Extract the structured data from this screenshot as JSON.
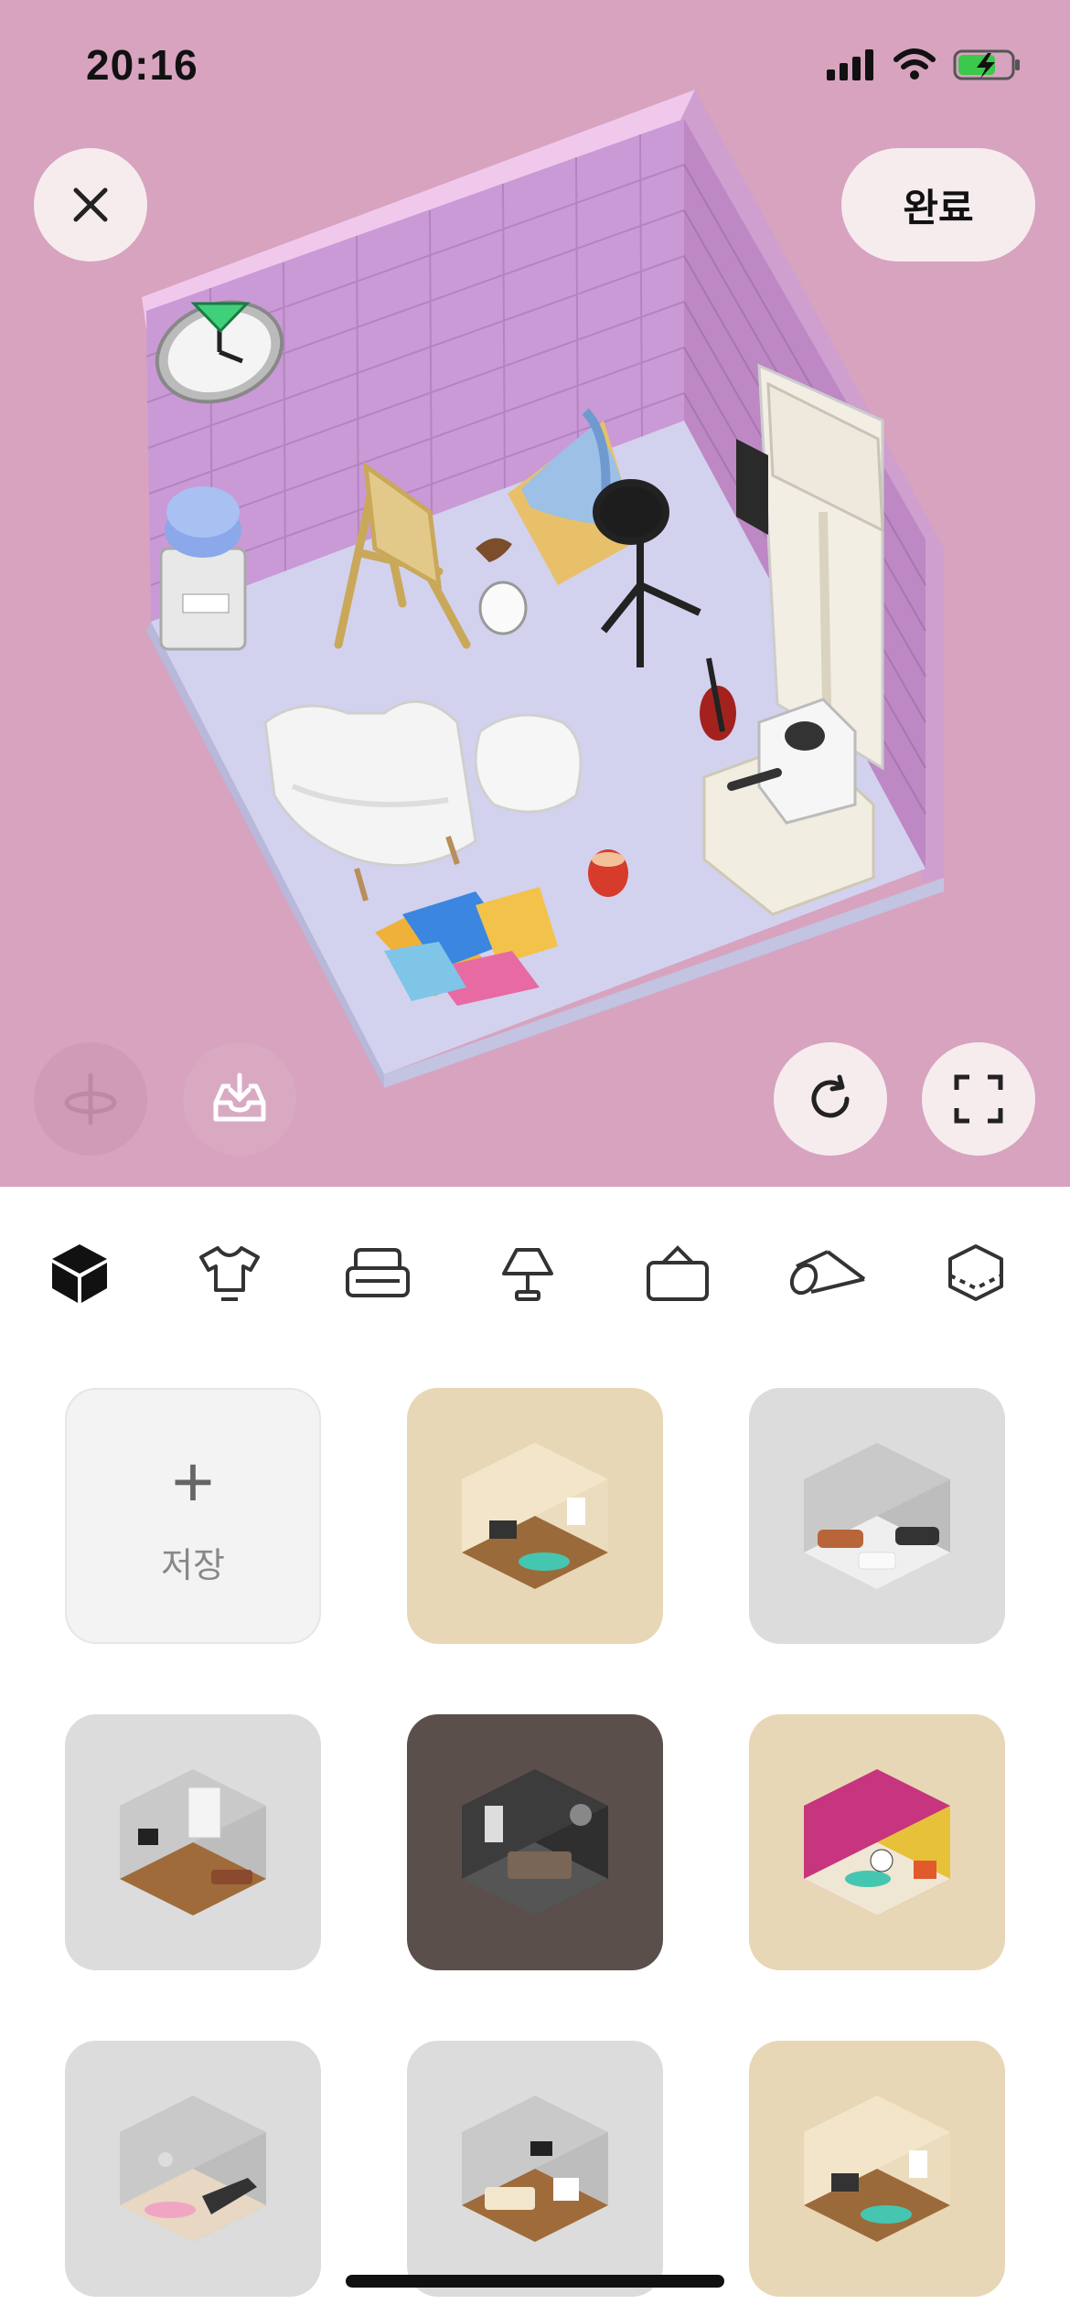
{
  "status_bar": {
    "time": "20:16"
  },
  "toolbar": {
    "done_label": "완료"
  },
  "tabs": [
    {
      "name": "preset",
      "icon": "cube-icon",
      "selected": true
    },
    {
      "name": "clothing",
      "icon": "shirt-icon",
      "selected": false
    },
    {
      "name": "furniture",
      "icon": "sofa-icon",
      "selected": false
    },
    {
      "name": "lighting",
      "icon": "lamp-icon",
      "selected": false
    },
    {
      "name": "wall-decor",
      "icon": "frame-icon",
      "selected": false
    },
    {
      "name": "flooring",
      "icon": "rug-icon",
      "selected": false
    },
    {
      "name": "room",
      "icon": "room-icon",
      "selected": false
    }
  ],
  "grid": {
    "save_tile": {
      "plus": "+",
      "label": "저장"
    },
    "presets": [
      {
        "theme": "beige living room",
        "bg": "#e8d7b6"
      },
      {
        "theme": "gray lounge",
        "bg": "#dcdcdc"
      },
      {
        "theme": "gray office",
        "bg": "#dcdcdc"
      },
      {
        "theme": "dark bedroom",
        "bg": "#5b4f4c"
      },
      {
        "theme": "music studio",
        "bg": "#e8d7b6"
      },
      {
        "theme": "gym room",
        "bg": "#dcdcdc"
      },
      {
        "theme": "gray bedroom",
        "bg": "#dcdcdc"
      },
      {
        "theme": "beige lounge",
        "bg": "#e8d7b6"
      }
    ]
  },
  "colors": {
    "scene_bg": "#d7a3bf",
    "wall": "#c79ad0",
    "floor": "#d2d2ee",
    "accent": "#111111"
  }
}
